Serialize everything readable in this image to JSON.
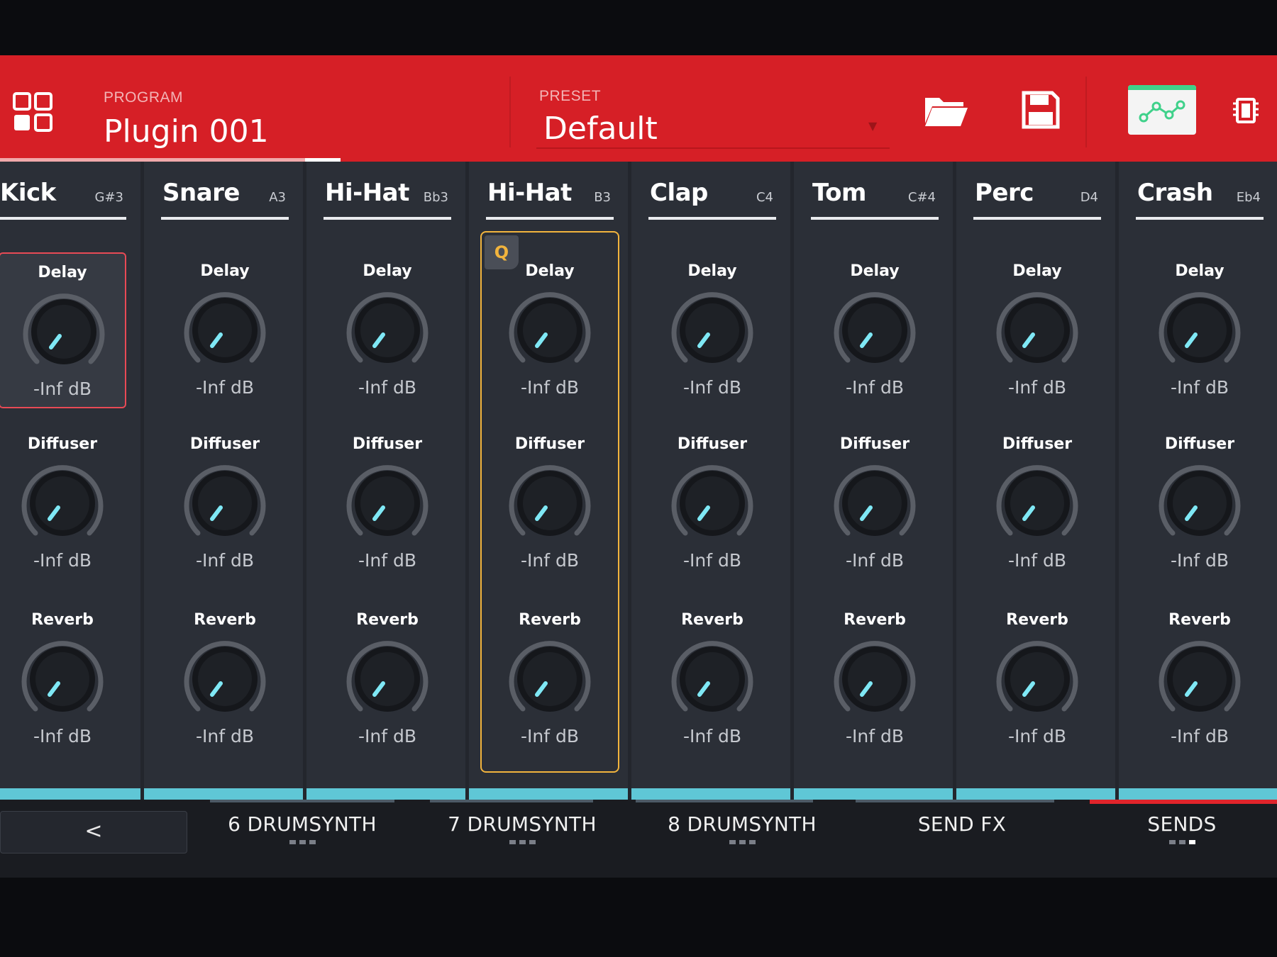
{
  "header": {
    "program_label": "PROGRAM",
    "program_name": "Plugin 001",
    "preset_label": "PRESET",
    "preset_name": "Default"
  },
  "channels": [
    {
      "name": "Kick",
      "note": "G#3",
      "sends": [
        {
          "label": "Delay",
          "value": "-Inf dB"
        },
        {
          "label": "Diffuser",
          "value": "-Inf dB"
        },
        {
          "label": "Reverb",
          "value": "-Inf dB"
        }
      ]
    },
    {
      "name": "Snare",
      "note": "A3",
      "sends": [
        {
          "label": "Delay",
          "value": "-Inf dB"
        },
        {
          "label": "Diffuser",
          "value": "-Inf dB"
        },
        {
          "label": "Reverb",
          "value": "-Inf dB"
        }
      ]
    },
    {
      "name": "Hi-Hat",
      "note": "Bb3",
      "sends": [
        {
          "label": "Delay",
          "value": "-Inf dB"
        },
        {
          "label": "Diffuser",
          "value": "-Inf dB"
        },
        {
          "label": "Reverb",
          "value": "-Inf dB"
        }
      ]
    },
    {
      "name": "Hi-Hat",
      "note": "B3",
      "q_label": "Q",
      "sends": [
        {
          "label": "Delay",
          "value": "-Inf dB"
        },
        {
          "label": "Diffuser",
          "value": "-Inf dB"
        },
        {
          "label": "Reverb",
          "value": "-Inf dB"
        }
      ]
    },
    {
      "name": "Clap",
      "note": "C4",
      "sends": [
        {
          "label": "Delay",
          "value": "-Inf dB"
        },
        {
          "label": "Diffuser",
          "value": "-Inf dB"
        },
        {
          "label": "Reverb",
          "value": "-Inf dB"
        }
      ]
    },
    {
      "name": "Tom",
      "note": "C#4",
      "sends": [
        {
          "label": "Delay",
          "value": "-Inf dB"
        },
        {
          "label": "Diffuser",
          "value": "-Inf dB"
        },
        {
          "label": "Reverb",
          "value": "-Inf dB"
        }
      ]
    },
    {
      "name": "Perc",
      "note": "D4",
      "sends": [
        {
          "label": "Delay",
          "value": "-Inf dB"
        },
        {
          "label": "Diffuser",
          "value": "-Inf dB"
        },
        {
          "label": "Reverb",
          "value": "-Inf dB"
        }
      ]
    },
    {
      "name": "Crash",
      "note": "Eb4",
      "sends": [
        {
          "label": "Delay",
          "value": "-Inf dB"
        },
        {
          "label": "Diffuser",
          "value": "-Inf dB"
        },
        {
          "label": "Reverb",
          "value": "-Inf dB"
        }
      ]
    }
  ],
  "footer": {
    "back_label": "<",
    "tabs": [
      {
        "label": "6 DRUMSYNTH",
        "active": false
      },
      {
        "label": "7 DRUMSYNTH",
        "active": false
      },
      {
        "label": "8 DRUMSYNTH",
        "active": false
      },
      {
        "label": "SEND FX",
        "active": false
      },
      {
        "label": "SENDS",
        "active": true
      }
    ]
  },
  "icons": {
    "grid": "grid-icon",
    "folder": "folder-icon",
    "save": "save-icon",
    "automation": "automation-icon",
    "chip": "chip-icon",
    "knob": "knob-icon"
  },
  "colors": {
    "header_bg": "#d61f26",
    "panel_bg": "#2b2f37",
    "knob_indicator": "#7fe8f5",
    "selected_border": "#e84a55",
    "q_accent": "#f2b43d",
    "channel_strip": "#5fc7d6",
    "automation_accent": "#3fd18a"
  }
}
